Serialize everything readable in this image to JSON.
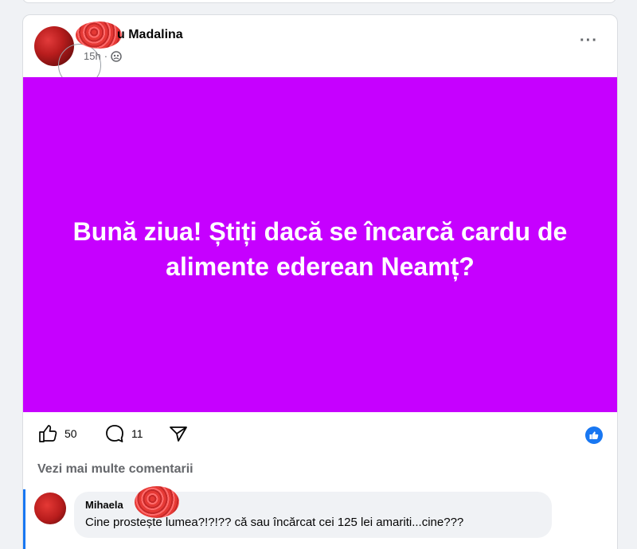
{
  "post": {
    "author": "u Madalina",
    "time": "15h",
    "privacy_icon": "friends-icon",
    "more_icon": "ellipsis-icon",
    "banner_text": "Bună ziua! Știți dacă se încarcă cardu de alimente ederean Neamț?",
    "banner_color": "#c600ff"
  },
  "actions": {
    "like_count": "50",
    "comment_count": "11",
    "reaction_badge": "like-icon"
  },
  "comments": {
    "see_more": "Vezi mai multe comentarii",
    "items": [
      {
        "name": "Mihaela",
        "text": "Cine prostește lumea?!?!?? că sau încărcat cei 125 lei amariti...cine???"
      }
    ]
  }
}
